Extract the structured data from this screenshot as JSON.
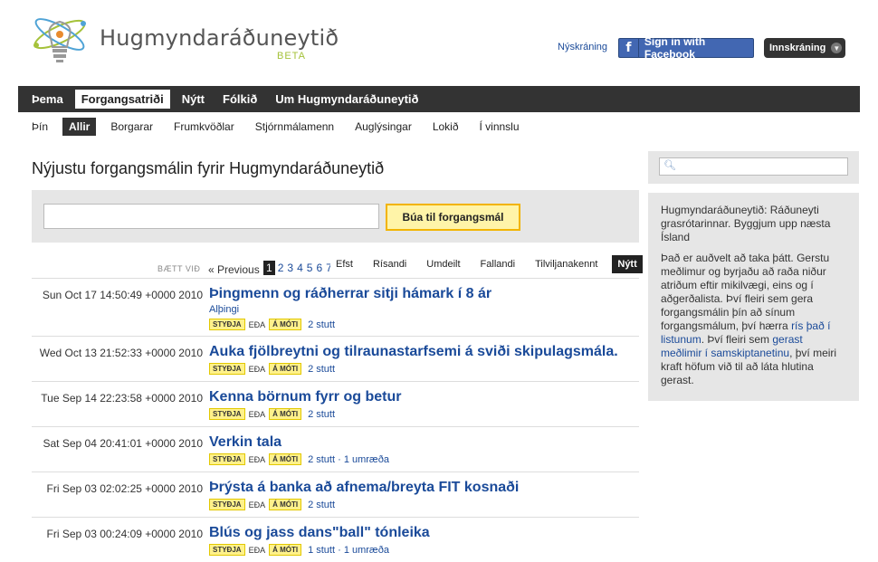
{
  "header": {
    "logo_name": "Hugmyndaráðuneytið",
    "logo_beta": "BETA",
    "signup": "Nýskráning",
    "facebook_button": "Sign in with Facebook",
    "login_button": "Innskráning"
  },
  "mainnav": {
    "items": [
      "Þema",
      "Forgangsatriði",
      "Nýtt",
      "Fólkið",
      "Um Hugmyndaráðuneytið"
    ]
  },
  "subnav": {
    "items": [
      "Þín",
      "Allir",
      "Borgarar",
      "Frumkvöðlar",
      "Stjórnmálamenn",
      "Auglýsingar",
      "Lokið",
      "Í vinnslu"
    ]
  },
  "main": {
    "title": "Nýjustu forgangsmálin fyrir Hugmyndaráðuneytið",
    "create_button": "Búa til forgangsmál",
    "added_label": "BÆTT VIÐ",
    "prev": "« Previous",
    "pages": [
      "1",
      "2",
      "3",
      "4",
      "5",
      "6",
      "7"
    ],
    "sort": [
      "Efst",
      "Rísandi",
      "Umdeilt",
      "Fallandi",
      "Tilviljanakennt",
      "Nýtt"
    ],
    "support": "STYÐJA",
    "or": "EÐA",
    "against": "Á MÓTI",
    "rows": [
      {
        "date": "Sun Oct 17 14:50:49 +0000 2010",
        "title": "Þingmenn og ráðherrar sitji hámark í 8 ár",
        "category": "Alþingi",
        "stats": "2 stutt"
      },
      {
        "date": "Wed Oct 13 21:52:33 +0000 2010",
        "title": "Auka fjölbreytni og tilraunastarfsemi á sviði skipulagsmála.",
        "category": "",
        "stats": "2 stutt"
      },
      {
        "date": "Tue Sep 14 22:23:58 +0000 2010",
        "title": "Kenna börnum fyrr og betur",
        "category": "",
        "stats": "2 stutt"
      },
      {
        "date": "Sat Sep 04 20:41:01 +0000 2010",
        "title": "Verkin tala",
        "category": "",
        "stats": "2 stutt · 1 umræða"
      },
      {
        "date": "Fri Sep 03 02:02:25 +0000 2010",
        "title": "Þrýsta á banka að afnema/breyta FIT kosnaði",
        "category": "",
        "stats": "2 stutt"
      },
      {
        "date": "Fri Sep 03 00:24:09 +0000 2010",
        "title": "Blús og jass dans\"ball\" tónleika",
        "category": "",
        "stats": "1 stutt · 1 umræða"
      }
    ]
  },
  "sidebar": {
    "intro": "Hugmyndaráðuneytið: Ráðuneyti grasrótarinnar. Byggjum upp næsta Ísland",
    "p2_a": "Það er auðvelt að taka þátt. Gerstu meðlimur og byrjaðu að raða niður atriðum eftir mikilvægi, eins og í aðgerðalista. Því fleiri sem gera forgangsmálin þín að sínum forgangsmálum, því hærra ",
    "p2_link1": "rís það í listunum",
    "p2_b": ". Því fleiri sem ",
    "p2_link2": "gerast meðlimir í samskiptanetinu",
    "p2_c": ", því meiri kraft höfum við til að láta hlutina gerast."
  }
}
